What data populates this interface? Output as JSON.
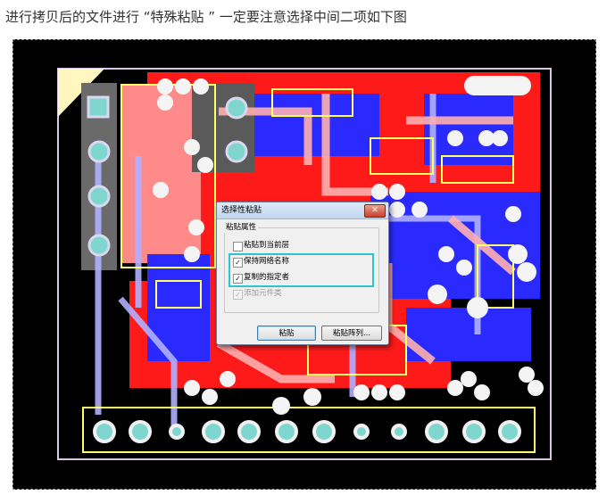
{
  "caption": "进行拷贝后的文件进行 “特殊粘贴 ” 一定要注意选择中间二项如下图",
  "dialog": {
    "title": "选择性粘贴",
    "close_glyph": "✕",
    "group_label": "粘贴属性",
    "options": [
      {
        "label": "粘贴到当前层",
        "checked": false,
        "disabled": false,
        "mark": ""
      },
      {
        "label": "保持网络名称",
        "checked": true,
        "disabled": false,
        "mark": "✓"
      },
      {
        "label": "复制的指定者",
        "checked": true,
        "disabled": false,
        "mark": "✓"
      },
      {
        "label": "添加元件类",
        "checked": true,
        "disabled": true,
        "mark": "✓"
      }
    ],
    "paste_button": "粘贴",
    "array_button": "粘贴阵列..."
  },
  "colors": {
    "board_bg": "#000000",
    "copper_top": "#ff1a1a",
    "copper_bottom": "#1a1aff",
    "pad": "#f0f0f0",
    "silkscreen": "#ffff66",
    "highlight": "#2cc4c8"
  }
}
